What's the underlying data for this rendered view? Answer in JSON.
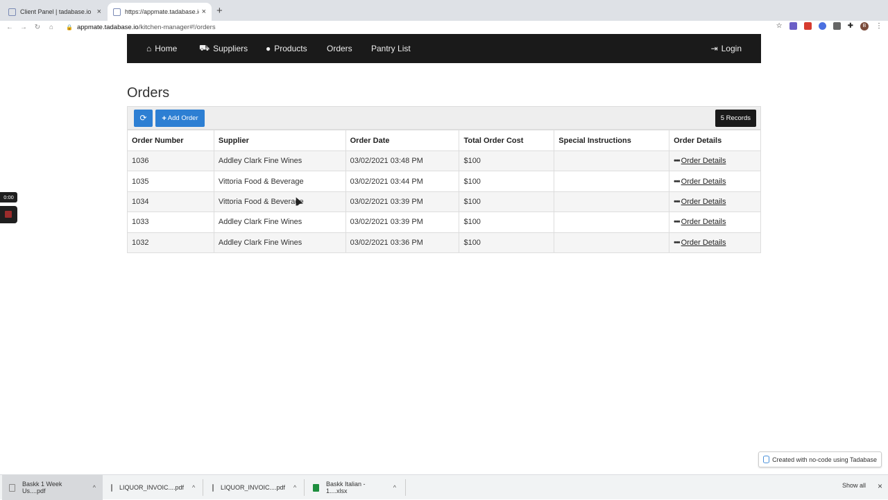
{
  "browser": {
    "tabs": [
      {
        "title": "Client Panel | tadabase.io",
        "close": "×"
      },
      {
        "title": "https://appmate.tadabase.io/ki",
        "close": "×"
      }
    ],
    "new_tab": "+",
    "nav": {
      "back": "←",
      "forward": "→",
      "reload": "↻",
      "home": "⌂"
    },
    "url_host": "appmate.tadabase.io",
    "url_path": "/kitchen-manager#!/orders",
    "profile_initial": "B"
  },
  "app_nav": {
    "home": "Home",
    "suppliers": "Suppliers",
    "products": "Products",
    "orders": "Orders",
    "pantry": "Pantry List",
    "login": "Login"
  },
  "page": {
    "title": "Orders",
    "add_order": "Add Order",
    "records": "5 Records"
  },
  "table": {
    "headers": [
      "Order Number",
      "Supplier",
      "Order Date",
      "Total Order Cost",
      "Special Instructions",
      "Order Details"
    ],
    "rows": [
      {
        "number": "1036",
        "supplier": "Addley Clark Fine Wines",
        "date": "03/02/2021 03:48 PM",
        "cost": "$100",
        "special": "",
        "details": "Order Details"
      },
      {
        "number": "1035",
        "supplier": "Vittoria Food & Beverage",
        "date": "03/02/2021 03:44 PM",
        "cost": "$100",
        "special": "",
        "details": "Order Details"
      },
      {
        "number": "1034",
        "supplier": "Vittoria Food & Beverage",
        "date": "03/02/2021 03:39 PM",
        "cost": "$100",
        "special": "",
        "details": "Order Details"
      },
      {
        "number": "1033",
        "supplier": "Addley Clark Fine Wines",
        "date": "03/02/2021 03:39 PM",
        "cost": "$100",
        "special": "",
        "details": "Order Details"
      },
      {
        "number": "1032",
        "supplier": "Addley Clark Fine Wines",
        "date": "03/02/2021 03:36 PM",
        "cost": "$100",
        "special": "",
        "details": "Order Details"
      }
    ]
  },
  "recorder": {
    "timer": "0:00"
  },
  "badge": "Created with no-code using Tadabase",
  "downloads": {
    "items": [
      {
        "name": "Baskk 1 Week Us....pdf"
      },
      {
        "name": "LIQUOR_INVOIC....pdf"
      },
      {
        "name": "LIQUOR_INVOIC....pdf"
      },
      {
        "name": "Baskk Italian - 1....xlsx"
      }
    ],
    "show_all": "Show all",
    "close": "×"
  },
  "colors": {
    "nav_bg": "#1a1a1a",
    "button": "#2d7fd3",
    "badge_bg": "#1a1a1a"
  }
}
